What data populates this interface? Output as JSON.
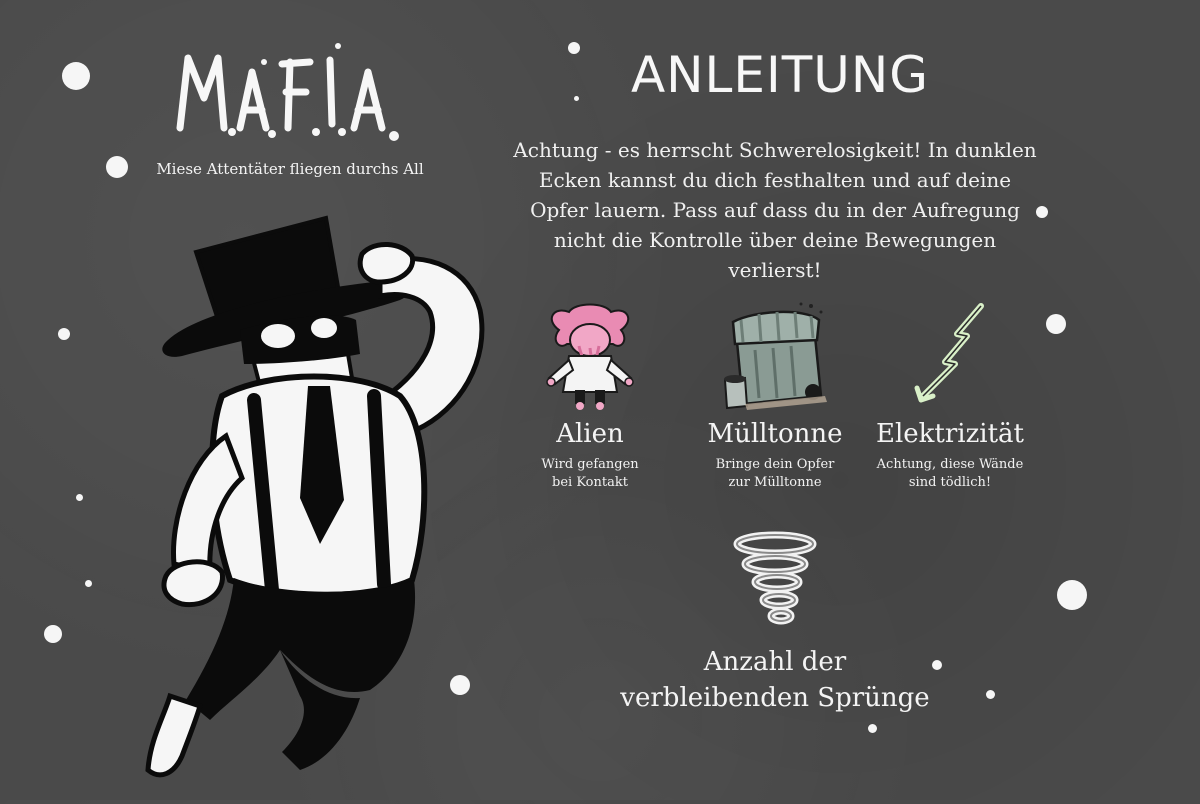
{
  "game": {
    "title": "M.A.F.I.A.",
    "subtitle": "Miese Attentäter fliegen durchs All"
  },
  "instructions": {
    "heading": "ANLEITUNG",
    "intro": "Achtung - es herrscht Schwerelosigkeit! In dunklen Ecken kannst du dich festhalten und auf deine Opfer lauern. Pass auf dass du in der Aufregung nicht die Kontrolle über deine Bewegungen verlierst!"
  },
  "hints": [
    {
      "title": "Alien",
      "desc_line1": "Wird gefangen",
      "desc_line2": "bei Kontakt",
      "icon": "alien-icon",
      "color": "#e98bb3"
    },
    {
      "title": "Mülltonne",
      "desc_line1": "Bringe dein Opfer",
      "desc_line2": "zur Mülltonne",
      "icon": "trash-bin-icon",
      "color": "#7f938c"
    },
    {
      "title": "Elektrizität",
      "desc_line1": "Achtung, diese Wände",
      "desc_line2": "sind tödlich!",
      "icon": "lightning-icon",
      "color": "#d9f0c8"
    }
  ],
  "jumps": {
    "line1": "Anzahl der",
    "line2": "verbleibenden Sprünge",
    "icon": "tornado-icon"
  }
}
